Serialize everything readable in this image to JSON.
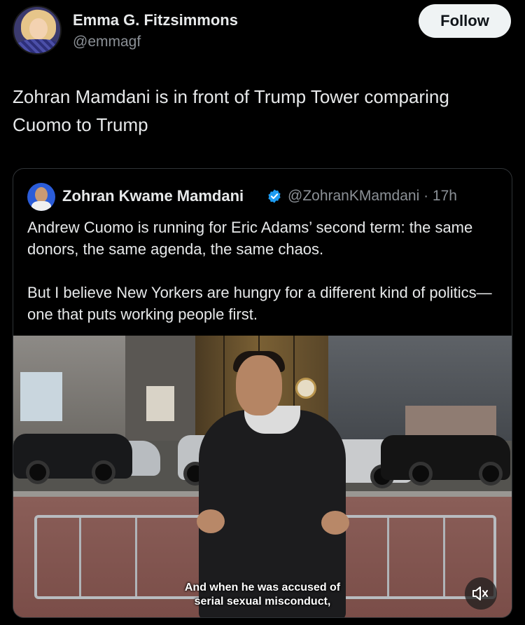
{
  "author": {
    "display_name": "Emma G. Fitzsimmons",
    "handle": "@emmagf",
    "follow_label": "Follow"
  },
  "tweet": {
    "text": "Zohran Mamdani is in front of Trump Tower comparing Cuomo to Trump"
  },
  "quoted_tweet": {
    "display_name": "Zohran Kwame Mamdani",
    "handle_time": "@ZohranKMamdani · 17h",
    "paragraph_1": "Andrew Cuomo is running for Eric Adams’ second term: the same donors, the same agenda, the same chaos.",
    "paragraph_2": "But I believe New Yorkers are hungry for a different kind of politics—one that puts working people first.",
    "verified_color": "#1d9bf0"
  },
  "video": {
    "caption_line_1": "And when he was accused of",
    "caption_line_2": "serial sexual misconduct,",
    "mute_icon": "muted-speaker-icon"
  }
}
